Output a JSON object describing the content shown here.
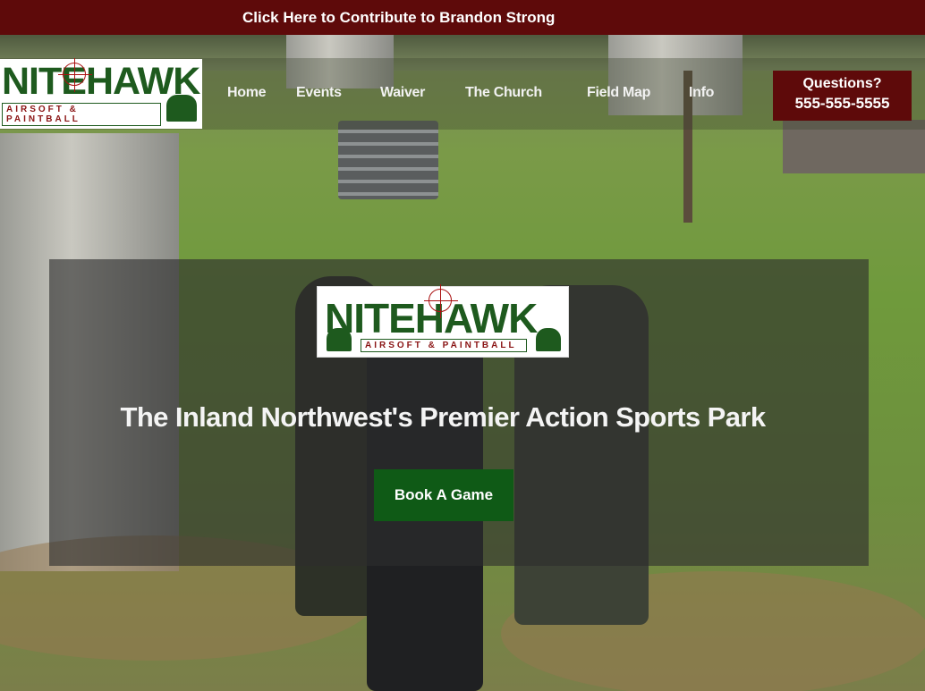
{
  "top_banner": {
    "link_text": "Click Here to Contribute to Brandon Strong"
  },
  "header": {
    "logo": {
      "word": "NITEHAWK",
      "tagline": "AIRSOFT & PAINTBALL"
    },
    "nav": [
      {
        "label": "Home"
      },
      {
        "label": "Events"
      },
      {
        "label": "Waiver"
      },
      {
        "label": "The Church"
      },
      {
        "label": "Field Map"
      },
      {
        "label": "Info"
      }
    ],
    "contact": {
      "line1": "Questions?",
      "phone": "555-555-5555"
    }
  },
  "hero": {
    "logo": {
      "word": "NITEHAWK",
      "tagline": "AIRSOFT & PAINTBALL"
    },
    "title": "The Inland Northwest's Premier Action Sports Park",
    "cta_label": "Book A Game"
  },
  "colors": {
    "banner": "#5e0a0a",
    "brand_green": "#1e5a1e",
    "cta": "#0f5a16"
  }
}
